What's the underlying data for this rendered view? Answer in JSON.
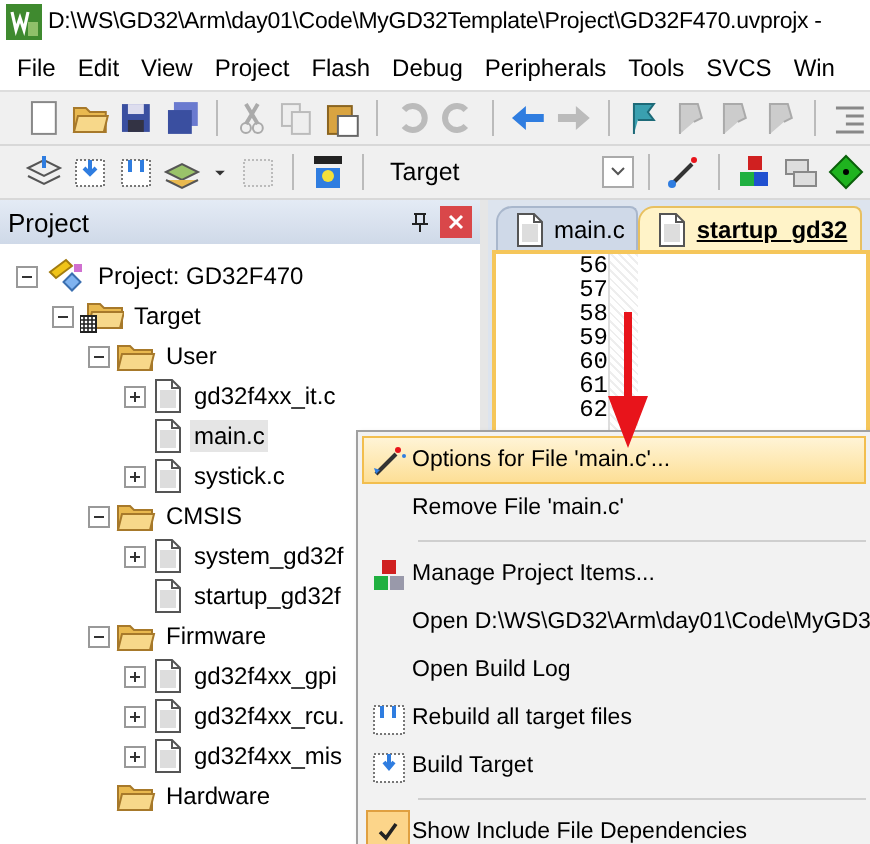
{
  "window": {
    "title": "D:\\WS\\GD32\\Arm\\day01\\Code\\MyGD32Template\\Project\\GD32F470.uvprojx -"
  },
  "menu_bar": [
    "File",
    "Edit",
    "View",
    "Project",
    "Flash",
    "Debug",
    "Peripherals",
    "Tools",
    "SVCS",
    "Win"
  ],
  "build_toolbar": {
    "target": "Target"
  },
  "project_panel": {
    "title": "Project",
    "tree": [
      {
        "kind": "project",
        "label": "Project: GD32F470",
        "expanded": true,
        "selected": false,
        "children": [
          {
            "kind": "target",
            "label": "Target",
            "expanded": true,
            "selected": false,
            "children": [
              {
                "kind": "folder",
                "label": "User",
                "expanded": true,
                "selected": false,
                "children": [
                  {
                    "kind": "file",
                    "label": "gd32f4xx_it.c",
                    "expanded": false,
                    "selected": false
                  },
                  {
                    "kind": "file",
                    "label": "main.c",
                    "selected": true
                  },
                  {
                    "kind": "file",
                    "label": "systick.c",
                    "expanded": false,
                    "selected": false
                  }
                ]
              },
              {
                "kind": "folder",
                "label": "CMSIS",
                "expanded": true,
                "selected": false,
                "children": [
                  {
                    "kind": "file",
                    "label": "system_gd32f",
                    "expanded": false,
                    "selected": false
                  },
                  {
                    "kind": "file",
                    "label": "startup_gd32f",
                    "selected": false
                  }
                ]
              },
              {
                "kind": "folder",
                "label": "Firmware",
                "expanded": true,
                "selected": false,
                "children": [
                  {
                    "kind": "file",
                    "label": "gd32f4xx_gpi",
                    "expanded": false,
                    "selected": false
                  },
                  {
                    "kind": "file",
                    "label": "gd32f4xx_rcu.",
                    "expanded": false,
                    "selected": false
                  },
                  {
                    "kind": "file",
                    "label": "gd32f4xx_mis",
                    "expanded": false,
                    "selected": false
                  }
                ]
              },
              {
                "kind": "folder",
                "label": "Hardware",
                "selected": false
              }
            ]
          }
        ]
      }
    ]
  },
  "editor": {
    "tabs": [
      {
        "label": "main.c",
        "selected": false
      },
      {
        "label": "startup_gd32",
        "selected": true
      }
    ],
    "line_numbers": [
      "56",
      "57",
      "58",
      "59",
      "60",
      "61",
      "62"
    ]
  },
  "context_menu": {
    "items": [
      {
        "kind": "item",
        "label": "Options for File 'main.c'...",
        "highlighted": true
      },
      {
        "kind": "item",
        "label": "Remove File 'main.c'",
        "highlighted": false
      },
      {
        "kind": "separator"
      },
      {
        "kind": "item",
        "label": "Manage Project Items...",
        "highlighted": false
      },
      {
        "kind": "item",
        "label": "Open D:\\WS\\GD32\\Arm\\day01\\Code\\MyGD3",
        "highlighted": false
      },
      {
        "kind": "item",
        "label": "Open Build Log",
        "highlighted": false
      },
      {
        "kind": "item",
        "label": "Rebuild all target files",
        "highlighted": false
      },
      {
        "kind": "item",
        "label": "Build Target",
        "highlighted": false
      },
      {
        "kind": "separator"
      },
      {
        "kind": "check",
        "label": "Show Include File Dependencies",
        "checked": true
      }
    ]
  }
}
